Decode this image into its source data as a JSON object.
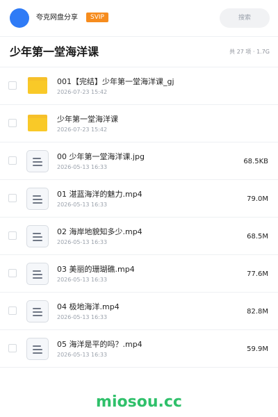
{
  "header": {
    "app_name": "夸克网盘分享",
    "vip_badge": "SVIP",
    "search_placeholder": "搜索"
  },
  "folder": {
    "title": "少年第一堂海洋课",
    "meta": "共 27 项 · 1.7G"
  },
  "items": [
    {
      "name": "001【完结】少年第一堂海洋课_gj",
      "date": "2026-07-23 15:42",
      "size": "",
      "type": "folder"
    },
    {
      "name": "少年第一堂海洋课",
      "date": "2026-07-23 15:42",
      "size": "",
      "type": "folder"
    },
    {
      "name": "00 少年第一堂海洋课.jpg",
      "date": "2026-05-13 16:33",
      "size": "68.5KB",
      "type": "file"
    },
    {
      "name": "01 湛蓝海洋的魅力.mp4",
      "date": "2026-05-13 16:33",
      "size": "79.0M",
      "type": "file"
    },
    {
      "name": "02 海岸地貌知多少.mp4",
      "date": "2026-05-13 16:33",
      "size": "68.5M",
      "type": "file"
    },
    {
      "name": "03 美丽的珊瑚礁.mp4",
      "date": "2026-05-13 16:33",
      "size": "77.6M",
      "type": "file"
    },
    {
      "name": "04 极地海洋.mp4",
      "date": "2026-05-13 16:33",
      "size": "82.8M",
      "type": "file"
    },
    {
      "name": "05 海洋是平的吗？.mp4",
      "date": "2026-05-13 16:33",
      "size": "59.9M",
      "type": "file"
    }
  ],
  "watermark": "miosou.cc",
  "colors": {
    "accent": "#2f7bf6",
    "vip": "#f68c1e",
    "folder": "#f9c928",
    "watermark": "#2fc06a"
  }
}
